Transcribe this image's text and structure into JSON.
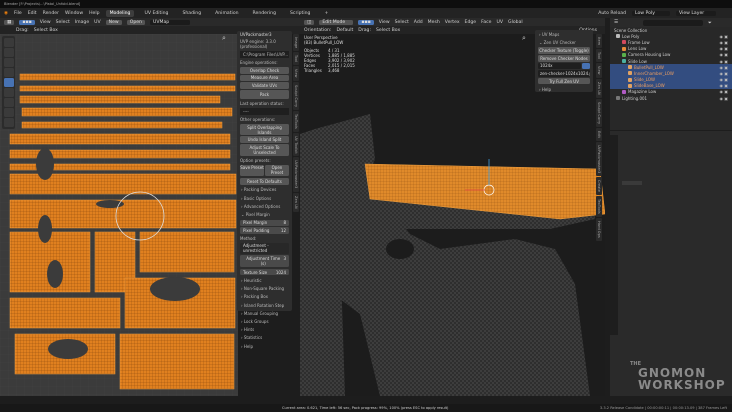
{
  "title": "Blender [F:\\Projects\\...\\Pistol_Unfold.blend]",
  "menu": [
    "File",
    "Edit",
    "Render",
    "Window",
    "Help"
  ],
  "workspaces": [
    "Modeling",
    "UV Editing",
    "Shading",
    "Animation",
    "Rendering",
    "Scripting",
    "+"
  ],
  "active_workspace": "Modeling",
  "topright": {
    "auto_reload": "Auto Reload",
    "scene": "Low Poly",
    "view_layer": "View Layer"
  },
  "uv_header": {
    "items": [
      "View",
      "Select",
      "Image",
      "UV"
    ],
    "new": "New",
    "open": "Open",
    "uvmap": "UVMap",
    "drag": "Drag:",
    "select_box": "Select Box"
  },
  "view3d_header": {
    "mode": "Edit Mode",
    "items": [
      "View",
      "Select",
      "Add",
      "Mesh",
      "Vertex",
      "Edge",
      "Face",
      "UV"
    ],
    "transform": "Global",
    "orientation": "Orientation:",
    "default": "Default",
    "drag": "Drag:",
    "select_box": "Select Box",
    "options": "Options"
  },
  "uvpackmaster": {
    "title": "UVPackmaster3",
    "engine": "UVP engine: 3.3.0 (professional)",
    "path": "C:\\Program Files\\UVP...",
    "engine_ops_label": "Engine operations:",
    "engine_ops": [
      "Overlap Check",
      "Measure Area",
      "Validate UVs",
      "Pack"
    ],
    "last_status_label": "Last operation status:",
    "last_status": "----",
    "other_ops_label": "Other operations:",
    "other_ops": [
      "Split Overlapping Islands",
      "Undo Island Split",
      "Adjust Scale To Unselected"
    ],
    "presets_label": "Option presets:",
    "save_preset": "Save Preset",
    "open_preset": "Open Preset",
    "reset": "Reset To Defaults",
    "sections_top": [
      "Packing Devices",
      "Basic Options",
      "Advanced Options",
      "Pixel Margin"
    ],
    "pixel_margin_label": "Pixel Margin",
    "pixel_margin": "8",
    "pixel_padding_label": "Pixel Padding",
    "pixel_padding": "12",
    "method_label": "Method:",
    "method": "Adjustment - unrestricted",
    "adjustment_time_label": "Adjustment Time (s)",
    "adjustment_time": "3",
    "texture_size_label": "Texture Size",
    "texture_size": "1024",
    "sections_bottom": [
      "Heuristic",
      "Non-Square Packing",
      "Packing Box",
      "Island Rotation Step",
      "Manual Grouping",
      "Lock Groups",
      "Hints",
      "Statistics",
      "Help"
    ]
  },
  "uv_tabs": [
    "Image",
    "Tool",
    "View",
    "Sculpt Carry",
    "TexTools",
    "UV Toolkit",
    "UVPackmaster3",
    "Zen UV"
  ],
  "viewport": {
    "perspective": "User Perspective",
    "object": "(83) BulletPull_LOW",
    "stats": [
      [
        "Objects",
        "4 / 31"
      ],
      [
        "Vertices",
        "1,885 / 1,885"
      ],
      [
        "Edges",
        "3,902 / 3,902"
      ],
      [
        "Faces",
        "2,015 / 2,015"
      ],
      [
        "Triangles",
        "3,468"
      ]
    ]
  },
  "zen_panel": {
    "uv_maps": "UV Maps",
    "checker_title": "Zen UV Checker",
    "checker_toggle": "Checker Texture (Toggle)",
    "remove": "Remove Checker Nodes",
    "resolution": "1024x",
    "image": "zen-checker-1024x1024.png",
    "try": "Try Full Zen UV",
    "help": "Help"
  },
  "view3d_tabs": [
    "Item",
    "Tool",
    "View",
    "Zen UV",
    "Sculpt Carry",
    "Edit",
    "UVPackmaster3",
    "Create",
    "TexTools",
    "Hard Ops"
  ],
  "outliner": {
    "root": "Scene Collection",
    "rows": [
      {
        "name": "Low Poly",
        "color": "#bbbbbb",
        "indent": 0,
        "sel": false
      },
      {
        "name": "Frame Low",
        "color": "#d14a5e",
        "indent": 1,
        "sel": false
      },
      {
        "name": "Lens Low",
        "color": "#e68a3a",
        "indent": 1,
        "sel": false
      },
      {
        "name": "Camera Housing Low",
        "color": "#59b04b",
        "indent": 1,
        "sel": false
      },
      {
        "name": "Slide Low",
        "color": "#4bb0a2",
        "indent": 1,
        "sel": false
      },
      {
        "name": "BulletPull_LOW",
        "color": "#e2a262",
        "indent": 2,
        "sel": true
      },
      {
        "name": "InnerChamber_LOW",
        "color": "#e2a262",
        "indent": 2,
        "sel": true
      },
      {
        "name": "Slide_LOW",
        "color": "#e2a262",
        "indent": 2,
        "sel": true
      },
      {
        "name": "SlideBase_LOW",
        "color": "#e2a262",
        "indent": 2,
        "sel": true
      },
      {
        "name": "Magazine Low",
        "color": "#b05bc4",
        "indent": 1,
        "sel": false
      },
      {
        "name": "Lighting.001",
        "color": "#777777",
        "indent": 0,
        "sel": false
      }
    ]
  },
  "status": {
    "message": "Current area: 0.621, Time left: 56 sec, Pack progress: 99%, 100% (press ESC to apply result)",
    "version": "3.3.2 Release Candidate | 00:00:00:11 | 00:00:13.09 | 387 Frames Left"
  },
  "watermark": {
    "the": "THE",
    "line1": "GNOMON",
    "line2": "WORKSHOP"
  },
  "colors": {
    "accent": "#4772b3",
    "uv_orange": "#e0801f",
    "mesh_orange": "#e08a2a"
  }
}
